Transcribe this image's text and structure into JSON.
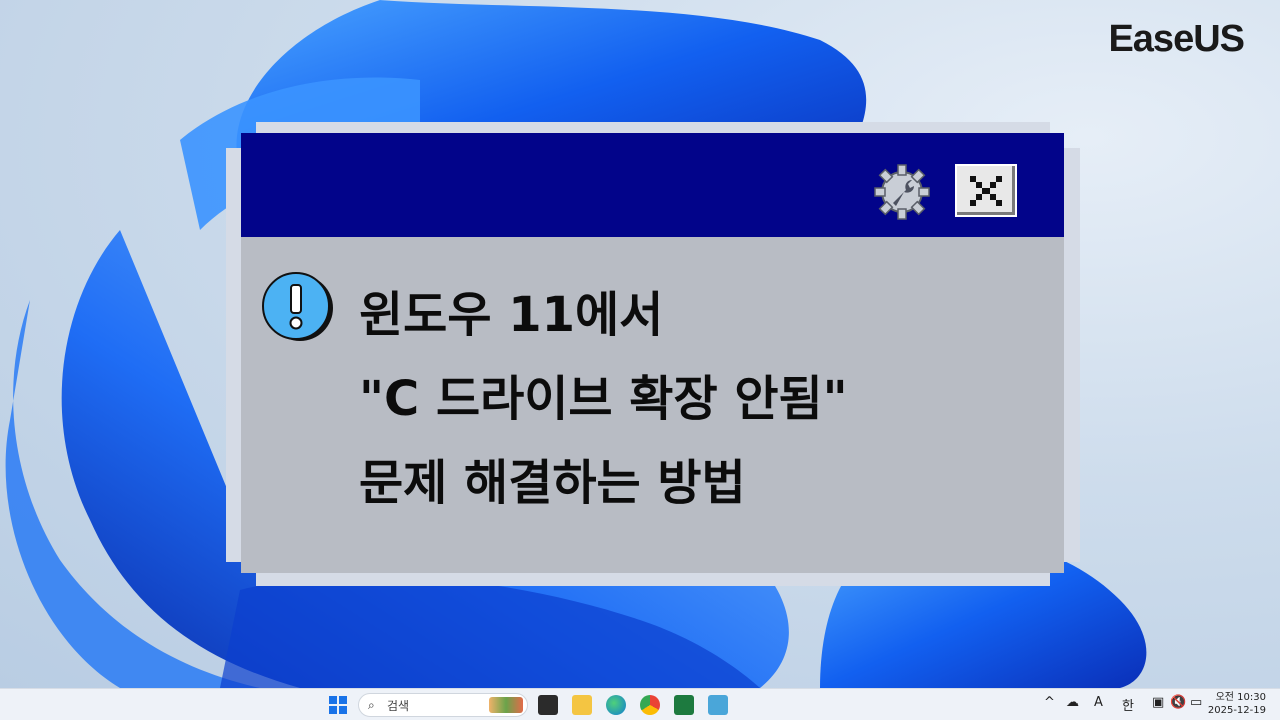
{
  "brand": {
    "logo_text": "EaseUS"
  },
  "dialog": {
    "line1": "윈도우 11에서",
    "line2": "\"C 드라이브 확장 안됨\"",
    "line3": "문제 해결하는 방법",
    "title_color": "#02048a",
    "body_color": "#b8bcc4"
  },
  "icons": {
    "settings": "gear-wrench-icon",
    "close": "close-icon",
    "warning": "exclamation-icon"
  },
  "taskbar": {
    "search_label": "검색",
    "tray_font": "A",
    "tray_ime": "한",
    "clock_time": "오전 10:30",
    "clock_date": "2025-12-19"
  }
}
